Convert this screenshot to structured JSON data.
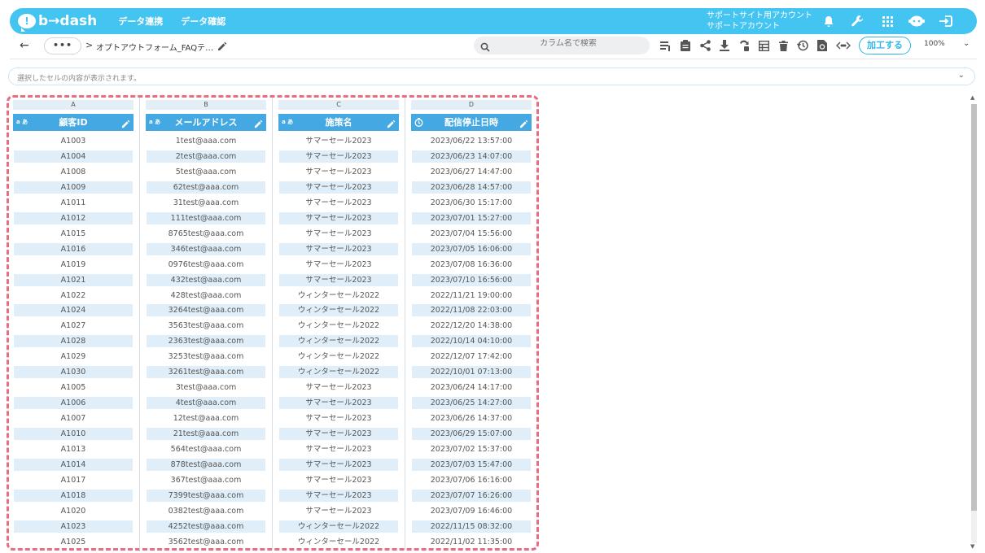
{
  "header": {
    "logo_text": "b→dash",
    "nav": [
      "データ連携",
      "データ確認"
    ],
    "account_line1": "サポートサイト用アカウント",
    "account_line2": "サポートアカウント"
  },
  "toolbar": {
    "breadcrumb": "オプトアウトフォーム_FAQテ…",
    "dots_label": "•••",
    "search_placeholder": "カラム名で検索",
    "process_label": "加工する",
    "zoom": "100%"
  },
  "cellbar": {
    "placeholder": "選択したセルの内容が表示されます。"
  },
  "colors": {
    "brand": "#44c4f0",
    "header_col": "#44a9e3",
    "alt_row": "#dfeef8",
    "dash_border": "#e96c7f"
  },
  "columns": [
    {
      "letter": "A",
      "name": "顧客ID",
      "type": "text-type-icon"
    },
    {
      "letter": "B",
      "name": "メールアドレス",
      "type": "text-type-icon"
    },
    {
      "letter": "C",
      "name": "施策名",
      "type": "text-type-icon"
    },
    {
      "letter": "D",
      "name": "配信停止日時",
      "type": "datetime-type-icon"
    }
  ],
  "rows": [
    [
      "A1003",
      "1test@aaa.com",
      "サマーセール2023",
      "2023/06/22 13:57:00"
    ],
    [
      "A1004",
      "2test@aaa.com",
      "サマーセール2023",
      "2023/06/23 14:07:00"
    ],
    [
      "A1008",
      "5test@aaa.com",
      "サマーセール2023",
      "2023/06/27 14:47:00"
    ],
    [
      "A1009",
      "62test@aaa.com",
      "サマーセール2023",
      "2023/06/28 14:57:00"
    ],
    [
      "A1011",
      "31test@aaa.com",
      "サマーセール2023",
      "2023/06/30 15:17:00"
    ],
    [
      "A1012",
      "111test@aaa.com",
      "サマーセール2023",
      "2023/07/01 15:27:00"
    ],
    [
      "A1015",
      "8765test@aaa.com",
      "サマーセール2023",
      "2023/07/04 15:56:00"
    ],
    [
      "A1016",
      "346test@aaa.com",
      "サマーセール2023",
      "2023/07/05 16:06:00"
    ],
    [
      "A1019",
      "0976test@aaa.com",
      "サマーセール2023",
      "2023/07/08 16:36:00"
    ],
    [
      "A1021",
      "432test@aaa.com",
      "サマーセール2023",
      "2023/07/10 16:56:00"
    ],
    [
      "A1022",
      "428test@aaa.com",
      "ウィンターセール2022",
      "2022/11/21 19:00:00"
    ],
    [
      "A1024",
      "3264test@aaa.com",
      "ウィンターセール2022",
      "2022/11/08 22:03:00"
    ],
    [
      "A1027",
      "3563test@aaa.com",
      "ウィンターセール2022",
      "2022/12/20 14:38:00"
    ],
    [
      "A1028",
      "2363test@aaa.com",
      "ウィンターセール2022",
      "2022/10/14 04:10:00"
    ],
    [
      "A1029",
      "3253test@aaa.com",
      "ウィンターセール2022",
      "2022/12/07 17:42:00"
    ],
    [
      "A1030",
      "3261test@aaa.com",
      "ウィンターセール2022",
      "2022/10/01 07:13:00"
    ],
    [
      "A1005",
      "3test@aaa.com",
      "サマーセール2023",
      "2023/06/24 14:17:00"
    ],
    [
      "A1006",
      "4test@aaa.com",
      "サマーセール2023",
      "2023/06/25 14:27:00"
    ],
    [
      "A1007",
      "12test@aaa.com",
      "サマーセール2023",
      "2023/06/26 14:37:00"
    ],
    [
      "A1010",
      "21test@aaa.com",
      "サマーセール2023",
      "2023/06/29 15:07:00"
    ],
    [
      "A1013",
      "564test@aaa.com",
      "サマーセール2023",
      "2023/07/02 15:37:00"
    ],
    [
      "A1014",
      "878test@aaa.com",
      "サマーセール2023",
      "2023/07/03 15:47:00"
    ],
    [
      "A1017",
      "367test@aaa.com",
      "サマーセール2023",
      "2023/07/06 16:16:00"
    ],
    [
      "A1018",
      "7399test@aaa.com",
      "サマーセール2023",
      "2023/07/07 16:26:00"
    ],
    [
      "A1020",
      "0382test@aaa.com",
      "サマーセール2023",
      "2023/07/09 16:46:00"
    ],
    [
      "A1023",
      "4252test@aaa.com",
      "ウィンターセール2022",
      "2022/11/15 08:32:00"
    ],
    [
      "A1025",
      "3562test@aaa.com",
      "ウィンターセール2022",
      "2022/11/02 11:35:00"
    ]
  ]
}
